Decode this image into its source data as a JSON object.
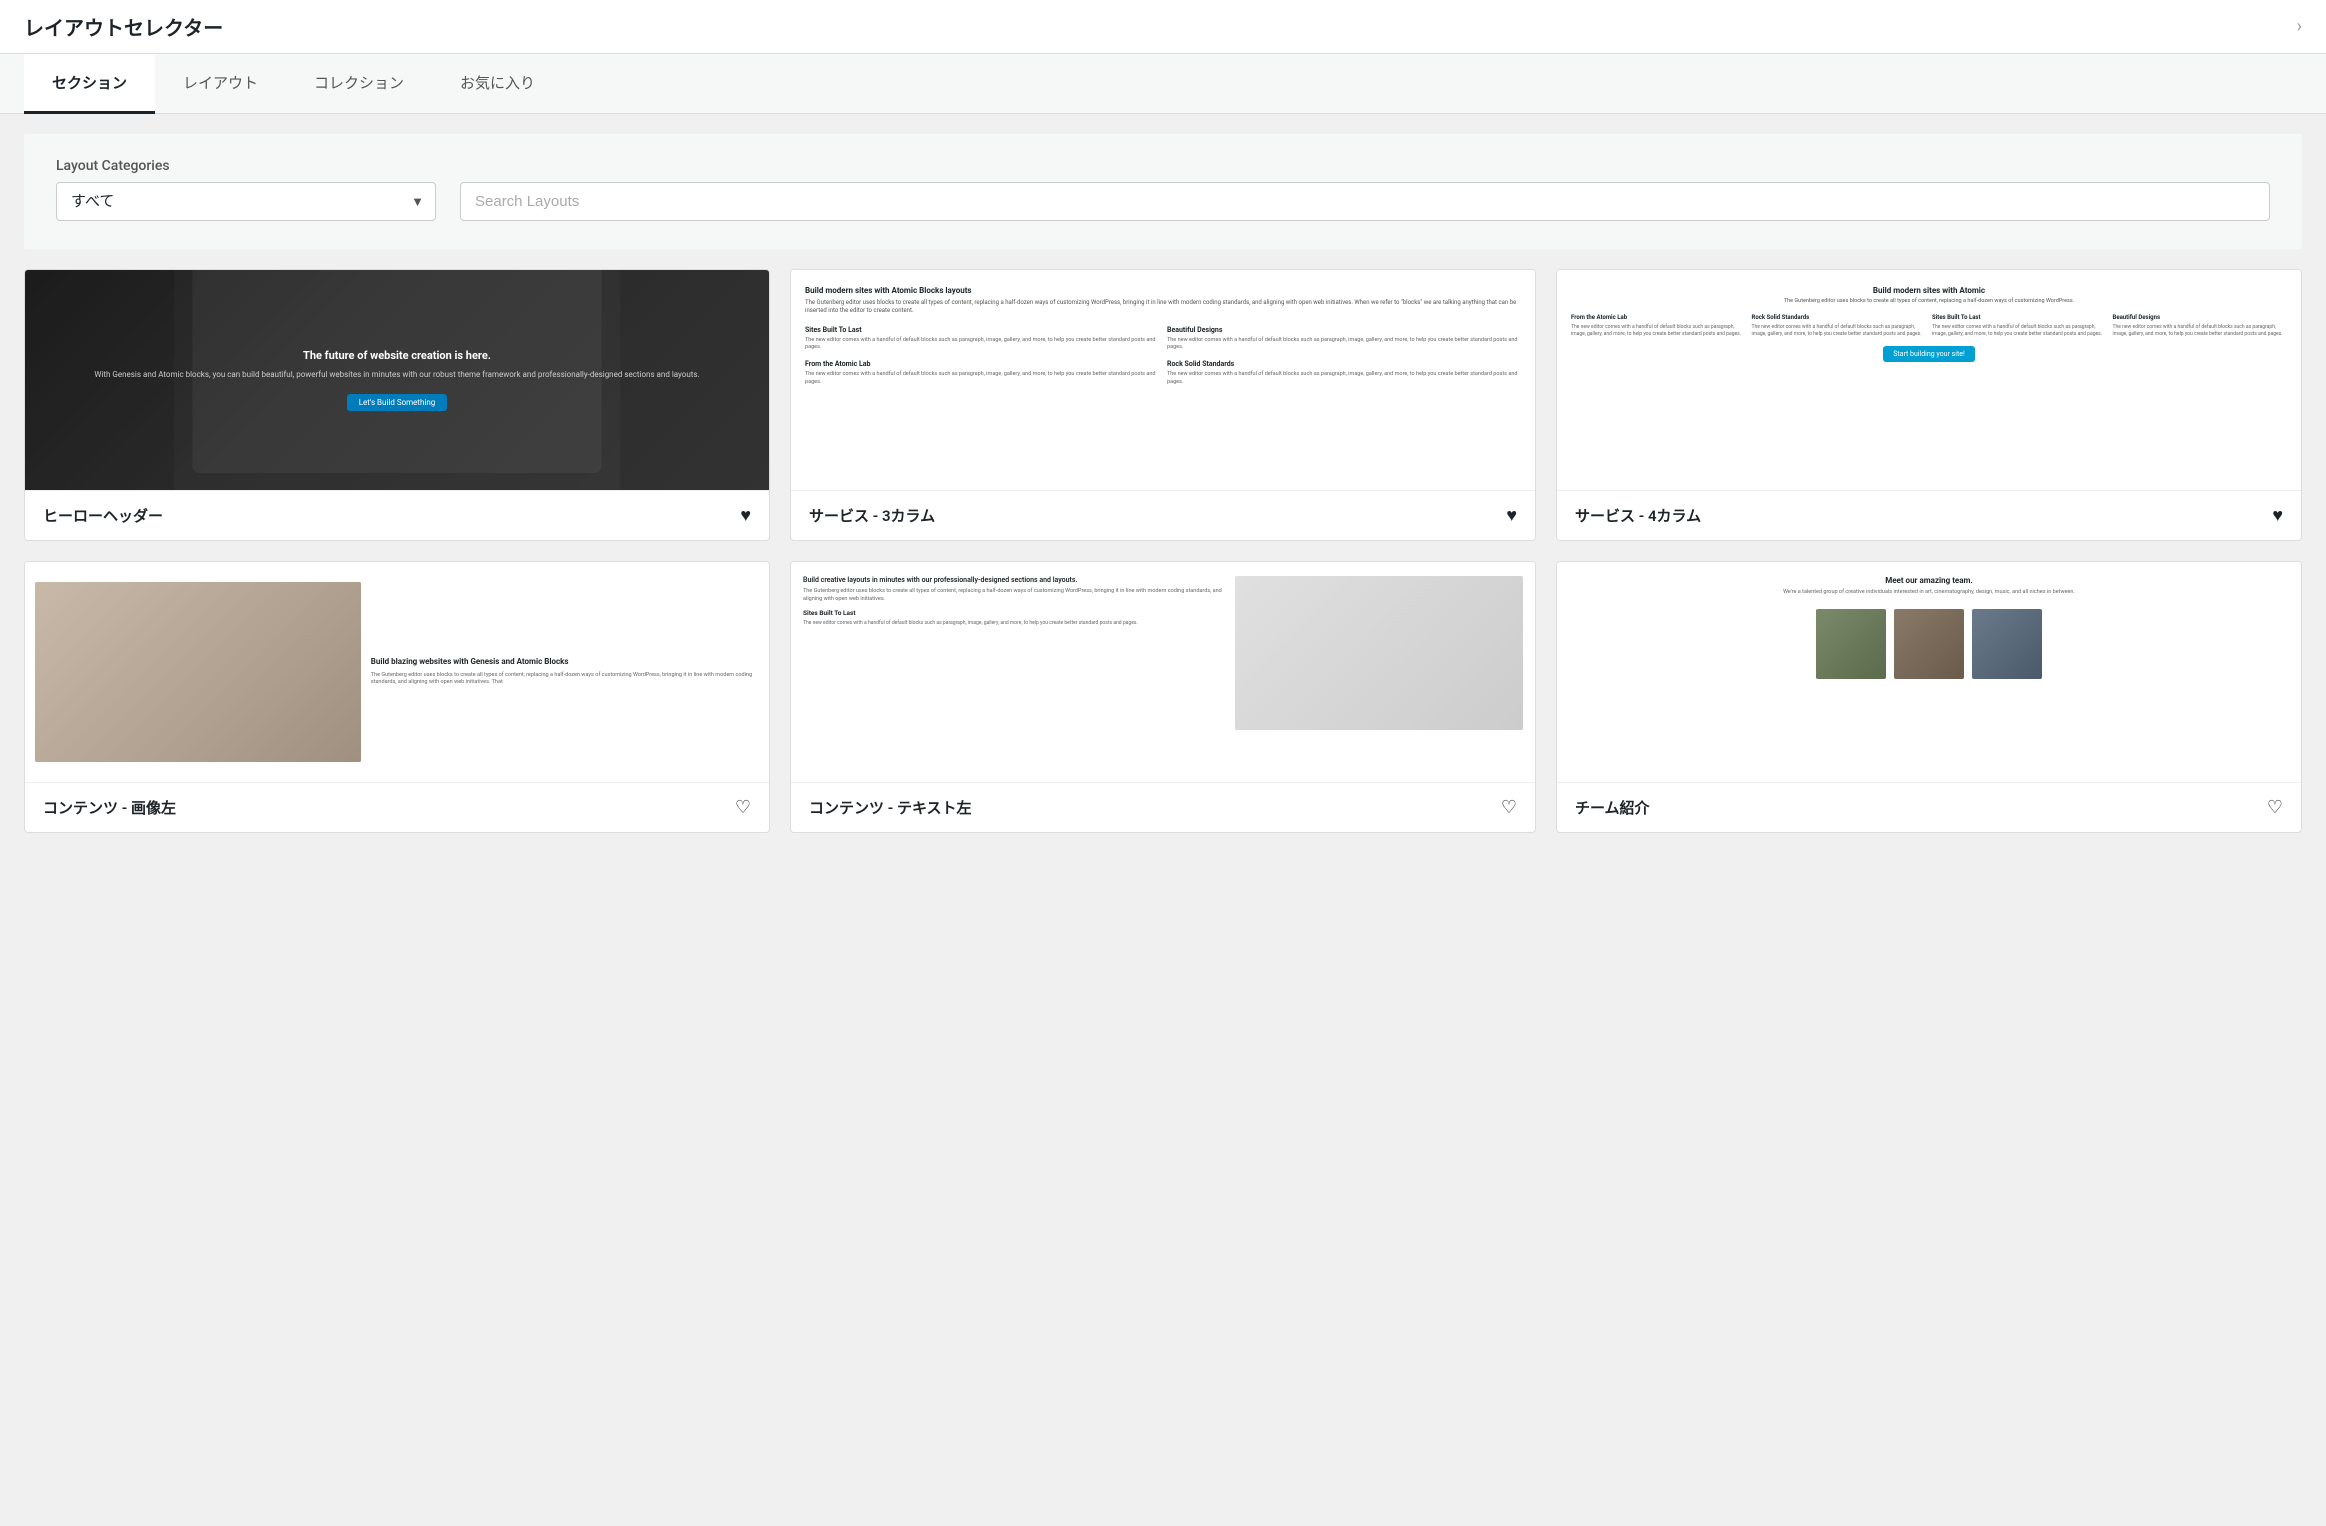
{
  "header": {
    "title": "レイアウトセレクター",
    "chevron": "›"
  },
  "tabs": [
    {
      "id": "sections",
      "label": "セクション",
      "active": true
    },
    {
      "id": "layouts",
      "label": "レイアウト",
      "active": false
    },
    {
      "id": "collections",
      "label": "コレクション",
      "active": false
    },
    {
      "id": "favorites",
      "label": "お気に入り",
      "active": false
    }
  ],
  "filter": {
    "categories_label": "Layout Categories",
    "select_default": "すべて",
    "search_placeholder": "Search Layouts"
  },
  "cards": [
    {
      "id": "hero-header",
      "name": "ヒーローヘッダー",
      "hero_title": "The future of website creation is here.",
      "hero_sub": "With Genesis and Atomic blocks, you can build beautiful, powerful websites in minutes with our robust theme framework and professionally-designed sections and layouts.",
      "hero_btn": "Let's Build Something",
      "favorited": true
    },
    {
      "id": "services-3col",
      "name": "サービス - 3カラム",
      "main_title": "Build modern sites with Atomic Blocks layouts",
      "intro": "The Gutenberg editor uses blocks to create all types of content, replacing a half-dozen ways of customizing WordPress, bringing it in line with modern coding standards, and aligning with open web initiatives. When we refer to \"blocks\" we are talking anything that can be inserted into the editor to create content.",
      "col1_title": "Sites Built To Last",
      "col1_text": "The new editor comes with a handful of default blocks such as paragraph, image, gallery, and more, to help you create better standard posts and pages.",
      "col2_title": "Beautiful Designs",
      "col2_text": "The new editor comes with a handful of default blocks such as paragraph, image, gallery, and more, to help you create better standard posts and pages.",
      "col3_title": "From the Atomic Lab",
      "col3_text": "The new editor comes with a handful of default blocks such as paragraph, image, gallery, and more, to help you create better standard posts and pages.",
      "col4_title": "Rock Solid Standards",
      "col4_text": "The new editor comes with a handful of default blocks such as paragraph, image, gallery, and more, to help you create better standard posts and pages.",
      "favorited": true
    },
    {
      "id": "services-4col",
      "name": "サービス - 4カラム",
      "main_title": "Build modern sites with Atomic",
      "intro": "The Gutenberg editor uses blocks to create all types of content, replacing a half-dozen ways of customizing WordPress.",
      "col1_title": "From the Atomic Lab",
      "col1_text": "The new editor comes with a handful of default blocks such as paragraph, image, gallery, and more, to help you create better standard posts and pages.",
      "col2_title": "Rock Solid Standards",
      "col2_text": "The new editor comes with a handful of default blocks such as paragraph, image, gallery, and more, to help you create better standard posts and pages.",
      "col3_title": "Sites Built To Last",
      "col3_text": "The new editor comes with a handful of default blocks such as paragraph, image, gallery, and more, to help you create better standard posts and pages.",
      "col4_title": "Beautiful Designs",
      "col4_text": "The new editor comes with a handful of default blocks such as paragraph, image, gallery, and more, to help you create better standard posts and pages.",
      "btn": "Start building your site!",
      "favorited": true
    },
    {
      "id": "img-text",
      "name": "コンテンツ - 画像左",
      "title": "Build blazing websites with Genesis and Atomic Blocks",
      "text": "The Gutenberg editor uses blocks to create all types of content, replacing a half-dozen ways of customizing WordPress, bringing it in line with modern coding standards, and aligning with open web initiatives. That",
      "favorited": false
    },
    {
      "id": "text-img",
      "name": "コンテンツ - テキスト左",
      "intro": "Build creative layouts in minutes with our professionally-designed sections and layouts.",
      "text": "The Gutenberg editor uses blocks to create all types of content, replacing a half-dozen ways of customizing WordPress, bringing it in line with modern coding standards, and aligning with open web initiatives.",
      "subtitle": "Sites Built To Last",
      "subtext": "The new editor comes with a handful of default blocks such as paragraph, image, gallery, and more, to help you create better standard posts and pages.",
      "favorited": false
    },
    {
      "id": "team",
      "name": "チーム紹介",
      "title": "Meet our amazing team.",
      "sub": "We're a talented group of creative individuals interested in art, cinematography, design, music, and all niches in between.",
      "favorited": false
    }
  ]
}
